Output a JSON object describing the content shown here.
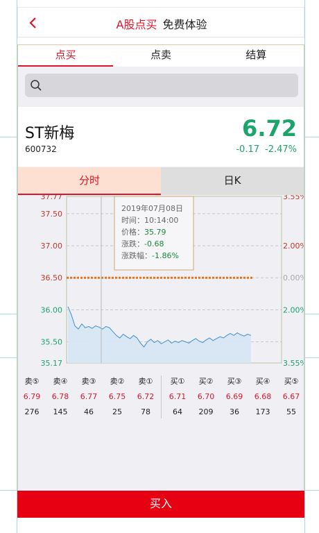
{
  "header": {
    "title_main": "A股点买",
    "title_sub": "免费体验"
  },
  "tabs": [
    {
      "label": "点买"
    },
    {
      "label": "点卖"
    },
    {
      "label": "结算"
    }
  ],
  "search": {
    "placeholder": ""
  },
  "stock": {
    "name": "ST新梅",
    "code": "600732",
    "price": "6.72",
    "change": "-0.17",
    "change_pct": "-2.47%"
  },
  "chart_tabs": [
    {
      "label": "分时"
    },
    {
      "label": "日K"
    }
  ],
  "chart_data": {
    "type": "area",
    "y_left_ticks": [
      "37.77",
      "37.50",
      "37.00",
      "36.50",
      "36.00",
      "35.50",
      "35.17"
    ],
    "y_right_ticks": [
      "3.55%",
      "2.00%",
      "0.00%",
      "2.00%",
      "3.55%"
    ],
    "ylim": [
      35.17,
      37.77
    ],
    "reference_price": 36.5,
    "series": [
      {
        "values": [
          36.05,
          35.92,
          35.75,
          35.7,
          35.78,
          35.72,
          35.74,
          35.71,
          35.75,
          35.73,
          35.7,
          35.74,
          35.72,
          35.66,
          35.6,
          35.56,
          35.62,
          35.58,
          35.55,
          35.6,
          35.56,
          35.48,
          35.42,
          35.5,
          35.54,
          35.49,
          35.52,
          35.47,
          35.5,
          35.53,
          35.48,
          35.51,
          35.49,
          35.52,
          35.5,
          35.48,
          35.52,
          35.55,
          35.51,
          35.49,
          35.53,
          35.56,
          35.52,
          35.55,
          35.58,
          35.56,
          35.6,
          35.63,
          35.6,
          35.64,
          35.61,
          35.59,
          35.62,
          35.6
        ]
      }
    ],
    "tooltip": {
      "date": "2019年07月08日",
      "time_label": "时间：",
      "time": "10:14:00",
      "price_label": "价格：",
      "price": "35.79",
      "change_label": "涨跌：",
      "change": "-0.68",
      "change_pct_label": "涨跌幅：",
      "change_pct": "-1.86%"
    },
    "grid": true
  },
  "orderbook": {
    "sell": [
      {
        "label": "卖⑤",
        "price": "6.79",
        "vol": "276"
      },
      {
        "label": "卖④",
        "price": "6.78",
        "vol": "145"
      },
      {
        "label": "卖③",
        "price": "6.77",
        "vol": "46"
      },
      {
        "label": "卖②",
        "price": "6.75",
        "vol": "25"
      },
      {
        "label": "卖①",
        "price": "6.72",
        "vol": "78"
      }
    ],
    "buy": [
      {
        "label": "买①",
        "price": "6.71",
        "vol": "64"
      },
      {
        "label": "买②",
        "price": "6.70",
        "vol": "209"
      },
      {
        "label": "买③",
        "price": "6.69",
        "vol": "36"
      },
      {
        "label": "买④",
        "price": "6.68",
        "vol": "173"
      },
      {
        "label": "买⑤",
        "price": "6.67",
        "vol": "55"
      }
    ]
  },
  "buy_button": {
    "label": "买入"
  },
  "colors": {
    "accent": "#e0152a",
    "down": "#1aa56b",
    "button": "#e60012",
    "line": "#3b8fd4",
    "ref": "#e8731a"
  }
}
